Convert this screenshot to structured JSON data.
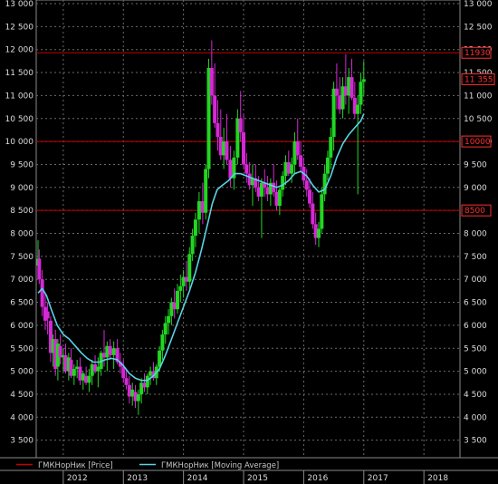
{
  "chart_data": {
    "type": "candlestick",
    "ylim": [
      3200,
      13000
    ],
    "y_ticks_left": [
      "13 000",
      "12 500",
      "12 000",
      "11 500",
      "11 000",
      "10 500",
      "10 000",
      "9 500",
      "9 000",
      "8 500",
      "8 000",
      "7 500",
      "7 000",
      "6 500",
      "6 000",
      "5 500",
      "5 000",
      "4 500",
      "4 000",
      "3 500"
    ],
    "y_ticks_right": [
      "13 000",
      "12 500",
      "12 000",
      "11 500",
      "11 000",
      "10 500",
      "10 000",
      "9 500",
      "9 000",
      "8 500",
      "8 000",
      "7 500",
      "7 000",
      "6 500",
      "6 000",
      "5 500",
      "5 000",
      "4 500",
      "4 000",
      "3 500"
    ],
    "tick_values": [
      13000,
      12500,
      12000,
      11500,
      11000,
      10500,
      10000,
      9500,
      9000,
      8500,
      8000,
      7500,
      7000,
      6500,
      6000,
      5500,
      5000,
      4500,
      4000,
      3500
    ],
    "x_labels": [
      "2012",
      "2013",
      "2014",
      "2015",
      "2016",
      "2017",
      "2018"
    ],
    "x_label_positions": [
      2012.0,
      2013.0,
      2014.0,
      2015.0,
      2016.0,
      2017.0,
      2018.0
    ],
    "x_range": [
      2011.55,
      2018.6
    ],
    "grid": true,
    "horizontal_levels": [
      {
        "value": 11930,
        "label": "11930"
      },
      {
        "value": 10000,
        "label": "10000"
      },
      {
        "value": 8500,
        "label": "8500"
      }
    ],
    "last_price": {
      "value": 11355,
      "label": "11 355"
    },
    "colors": {
      "up": "#22d622",
      "down": "#d628d6",
      "ma": "#5ad3e6",
      "level": "#c40000",
      "grid": "#6a6a6a"
    },
    "candles": [
      [
        2011.58,
        7300,
        7850,
        7250,
        7450
      ],
      [
        2011.6,
        7450,
        7650,
        6900,
        7000
      ],
      [
        2011.65,
        7000,
        7200,
        6200,
        6400
      ],
      [
        2011.7,
        6400,
        6700,
        5900,
        6100
      ],
      [
        2011.74,
        6300,
        6500,
        5800,
        6150
      ],
      [
        2011.79,
        6100,
        6200,
        5200,
        5400
      ],
      [
        2011.83,
        5400,
        5800,
        5100,
        5700
      ],
      [
        2011.87,
        5700,
        5900,
        4900,
        5050
      ],
      [
        2011.91,
        5100,
        5700,
        4800,
        5600
      ],
      [
        2011.95,
        5550,
        5800,
        5150,
        5300
      ],
      [
        2012.0,
        5300,
        5500,
        5000,
        5350
      ],
      [
        2012.04,
        5350,
        5600,
        4950,
        5000
      ],
      [
        2012.09,
        5000,
        5400,
        4800,
        5300
      ],
      [
        2012.13,
        5250,
        5500,
        4850,
        4900
      ],
      [
        2012.18,
        4900,
        5150,
        4700,
        5050
      ],
      [
        2012.23,
        5050,
        5250,
        4850,
        5100
      ],
      [
        2012.28,
        5100,
        5300,
        4700,
        4800
      ],
      [
        2012.33,
        4800,
        5000,
        4600,
        4950
      ],
      [
        2012.38,
        4900,
        5100,
        4700,
        4750
      ],
      [
        2012.43,
        4750,
        5050,
        4550,
        4900
      ],
      [
        2012.48,
        4900,
        5250,
        4700,
        5150
      ],
      [
        2012.53,
        5150,
        5350,
        4950,
        5000
      ],
      [
        2012.58,
        5000,
        5300,
        4650,
        5100
      ],
      [
        2012.63,
        5050,
        5450,
        4900,
        5400
      ],
      [
        2012.68,
        5400,
        5900,
        5100,
        5300
      ],
      [
        2012.73,
        5300,
        5650,
        5000,
        5550
      ],
      [
        2012.78,
        5550,
        5700,
        5250,
        5350
      ],
      [
        2012.84,
        5350,
        5650,
        5050,
        5500
      ],
      [
        2012.9,
        5500,
        5700,
        5150,
        5200
      ],
      [
        2012.95,
        5200,
        5400,
        4950,
        5100
      ],
      [
        2013.0,
        5100,
        5250,
        4750,
        4850
      ],
      [
        2013.05,
        4850,
        5050,
        4600,
        4700
      ],
      [
        2013.1,
        4700,
        4900,
        4300,
        4450
      ],
      [
        2013.15,
        4450,
        4750,
        4250,
        4600
      ],
      [
        2013.2,
        4550,
        4700,
        4200,
        4350
      ],
      [
        2013.25,
        4350,
        4600,
        4050,
        4500
      ],
      [
        2013.3,
        4500,
        4850,
        4300,
        4750
      ],
      [
        2013.35,
        4750,
        4950,
        4550,
        4650
      ],
      [
        2013.4,
        4650,
        4950,
        4500,
        4900
      ],
      [
        2013.45,
        4900,
        5100,
        4700,
        5000
      ],
      [
        2013.5,
        5000,
        5200,
        4800,
        4850
      ],
      [
        2013.55,
        4850,
        5150,
        4700,
        5100
      ],
      [
        2013.6,
        5100,
        5550,
        5000,
        5450
      ],
      [
        2013.65,
        5450,
        5900,
        5250,
        5800
      ],
      [
        2013.7,
        5800,
        6200,
        5600,
        6050
      ],
      [
        2013.75,
        6050,
        6350,
        5800,
        6200
      ],
      [
        2013.8,
        6200,
        6600,
        6000,
        6500
      ],
      [
        2013.85,
        6500,
        6800,
        6150,
        6350
      ],
      [
        2013.9,
        6350,
        6900,
        6250,
        6750
      ],
      [
        2013.95,
        6750,
        7100,
        6500,
        6850
      ],
      [
        2014.0,
        6850,
        7200,
        6600,
        7050
      ],
      [
        2014.05,
        7050,
        7400,
        6750,
        6950
      ],
      [
        2014.1,
        6950,
        7700,
        6800,
        7550
      ],
      [
        2014.15,
        7550,
        8100,
        7400,
        7950
      ],
      [
        2014.2,
        7950,
        8450,
        7700,
        8300
      ],
      [
        2014.26,
        8300,
        8900,
        8000,
        8700
      ],
      [
        2014.32,
        8700,
        9100,
        8200,
        8450
      ],
      [
        2014.37,
        8450,
        9500,
        8300,
        9400
      ],
      [
        2014.42,
        9400,
        11800,
        9200,
        11600
      ],
      [
        2014.47,
        11600,
        12200,
        10800,
        11000
      ],
      [
        2014.52,
        11000,
        11700,
        10300,
        10400
      ],
      [
        2014.57,
        10400,
        10900,
        9800,
        10100
      ],
      [
        2014.62,
        10100,
        10700,
        9600,
        9700
      ],
      [
        2014.67,
        9700,
        10300,
        9400,
        10000
      ],
      [
        2014.72,
        10000,
        10600,
        9500,
        9600
      ],
      [
        2014.78,
        9600,
        9900,
        9000,
        9200
      ],
      [
        2014.84,
        9200,
        9800,
        8950,
        9650
      ],
      [
        2014.9,
        9650,
        10700,
        9500,
        10500
      ],
      [
        2014.95,
        10500,
        11100,
        10000,
        10200
      ],
      [
        2015.0,
        10200,
        10600,
        9400,
        9500
      ],
      [
        2015.05,
        9500,
        9750,
        9100,
        9300
      ],
      [
        2015.1,
        9300,
        9550,
        8950,
        9050
      ],
      [
        2015.15,
        9050,
        9500,
        8600,
        9200
      ],
      [
        2015.2,
        9200,
        9500,
        8900,
        9000
      ],
      [
        2015.25,
        9000,
        9250,
        8700,
        8800
      ],
      [
        2015.3,
        8800,
        9200,
        7900,
        9100
      ],
      [
        2015.35,
        9100,
        9400,
        8800,
        9000
      ],
      [
        2015.4,
        9000,
        9250,
        8700,
        8850
      ],
      [
        2015.45,
        8850,
        9200,
        8600,
        9100
      ],
      [
        2015.5,
        9100,
        9500,
        8800,
        8900
      ],
      [
        2015.55,
        8900,
        9150,
        8500,
        8600
      ],
      [
        2015.6,
        8600,
        9000,
        8400,
        8950
      ],
      [
        2015.65,
        8950,
        9350,
        8800,
        9250
      ],
      [
        2015.7,
        9250,
        9700,
        9050,
        9550
      ],
      [
        2015.75,
        9550,
        9800,
        9250,
        9300
      ],
      [
        2015.8,
        9300,
        9650,
        9100,
        9500
      ],
      [
        2015.85,
        9500,
        10200,
        9300,
        10000
      ],
      [
        2015.9,
        10000,
        10500,
        9600,
        9700
      ],
      [
        2015.95,
        9700,
        10000,
        9350,
        9450
      ],
      [
        2016.0,
        9450,
        9650,
        9050,
        9150
      ],
      [
        2016.05,
        9150,
        9400,
        8800,
        8950
      ],
      [
        2016.1,
        8950,
        9200,
        8550,
        8650
      ],
      [
        2016.15,
        8650,
        8900,
        8100,
        8200
      ],
      [
        2016.2,
        8200,
        8450,
        7750,
        7900
      ],
      [
        2016.25,
        7900,
        8250,
        7700,
        8100
      ],
      [
        2016.3,
        8100,
        9000,
        8000,
        8850
      ],
      [
        2016.35,
        8850,
        9500,
        8700,
        9300
      ],
      [
        2016.4,
        9300,
        9800,
        9150,
        9650
      ],
      [
        2016.45,
        9650,
        10300,
        9400,
        10100
      ],
      [
        2016.5,
        10100,
        11300,
        9800,
        11150
      ],
      [
        2016.55,
        11150,
        11700,
        10700,
        11000
      ],
      [
        2016.6,
        11000,
        11400,
        10600,
        10700
      ],
      [
        2016.65,
        10700,
        11400,
        10500,
        11200
      ],
      [
        2016.7,
        11200,
        11900,
        10800,
        11000
      ],
      [
        2016.75,
        11000,
        11600,
        10600,
        11400
      ],
      [
        2016.8,
        11400,
        11800,
        10900,
        10950
      ],
      [
        2016.85,
        10950,
        11300,
        10500,
        10600
      ],
      [
        2016.9,
        10600,
        11000,
        8850,
        10800
      ],
      [
        2016.95,
        10800,
        11500,
        10600,
        11300
      ],
      [
        2017.0,
        11300,
        11750,
        11000,
        11355
      ]
    ],
    "ma_points": [
      [
        2011.58,
        6700
      ],
      [
        2011.65,
        6800
      ],
      [
        2011.72,
        6650
      ],
      [
        2011.8,
        6350
      ],
      [
        2011.9,
        6000
      ],
      [
        2012.0,
        5800
      ],
      [
        2012.1,
        5700
      ],
      [
        2012.2,
        5550
      ],
      [
        2012.3,
        5400
      ],
      [
        2012.4,
        5280
      ],
      [
        2012.5,
        5200
      ],
      [
        2012.6,
        5200
      ],
      [
        2012.7,
        5250
      ],
      [
        2012.8,
        5280
      ],
      [
        2012.9,
        5250
      ],
      [
        2013.0,
        5120
      ],
      [
        2013.1,
        4950
      ],
      [
        2013.2,
        4850
      ],
      [
        2013.3,
        4800
      ],
      [
        2013.4,
        4800
      ],
      [
        2013.5,
        4900
      ],
      [
        2013.6,
        5050
      ],
      [
        2013.7,
        5350
      ],
      [
        2013.8,
        5700
      ],
      [
        2013.9,
        6050
      ],
      [
        2014.0,
        6400
      ],
      [
        2014.1,
        6750
      ],
      [
        2014.2,
        7150
      ],
      [
        2014.3,
        7650
      ],
      [
        2014.4,
        8200
      ],
      [
        2014.48,
        8650
      ],
      [
        2014.56,
        8950
      ],
      [
        2014.65,
        9050
      ],
      [
        2014.75,
        9150
      ],
      [
        2014.85,
        9300
      ],
      [
        2014.95,
        9300
      ],
      [
        2015.05,
        9250
      ],
      [
        2015.15,
        9200
      ],
      [
        2015.25,
        9150
      ],
      [
        2015.35,
        9100
      ],
      [
        2015.45,
        9050
      ],
      [
        2015.55,
        9000
      ],
      [
        2015.65,
        9050
      ],
      [
        2015.75,
        9150
      ],
      [
        2015.85,
        9300
      ],
      [
        2015.95,
        9350
      ],
      [
        2016.05,
        9250
      ],
      [
        2016.15,
        9050
      ],
      [
        2016.25,
        8900
      ],
      [
        2016.35,
        8950
      ],
      [
        2016.45,
        9250
      ],
      [
        2016.55,
        9650
      ],
      [
        2016.65,
        9950
      ],
      [
        2016.75,
        10150
      ],
      [
        2016.85,
        10300
      ],
      [
        2016.95,
        10450
      ],
      [
        2017.0,
        10600
      ]
    ],
    "legend": [
      {
        "name": "ГМКНорНик [Price]",
        "color": "#c40000"
      },
      {
        "name": "ГМКНорНик [Moving Average]",
        "color": "#5ad3e6"
      }
    ]
  }
}
